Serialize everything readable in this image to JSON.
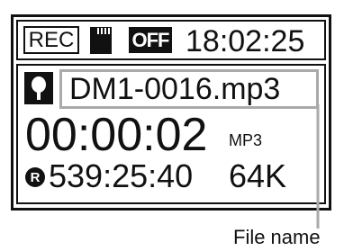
{
  "status": {
    "rec_label": "REC",
    "card_icon": "sd-card-icon",
    "off_label": "OFF",
    "clock": "18:02:25"
  },
  "file": {
    "mic_icon": "microphone-icon",
    "name": "DM1-0016.mp3"
  },
  "timer": {
    "elapsed": "00:00:02",
    "format": "MP3"
  },
  "remaining": {
    "icon": "remaining-r-icon",
    "icon_letter": "R",
    "time": "539:25:40",
    "bitrate": "64K"
  },
  "callout": {
    "label": "File name"
  },
  "colors": {
    "lcd_ink": "#111111",
    "highlight_frame": "#aaaaaa",
    "background": "#ffffff"
  }
}
